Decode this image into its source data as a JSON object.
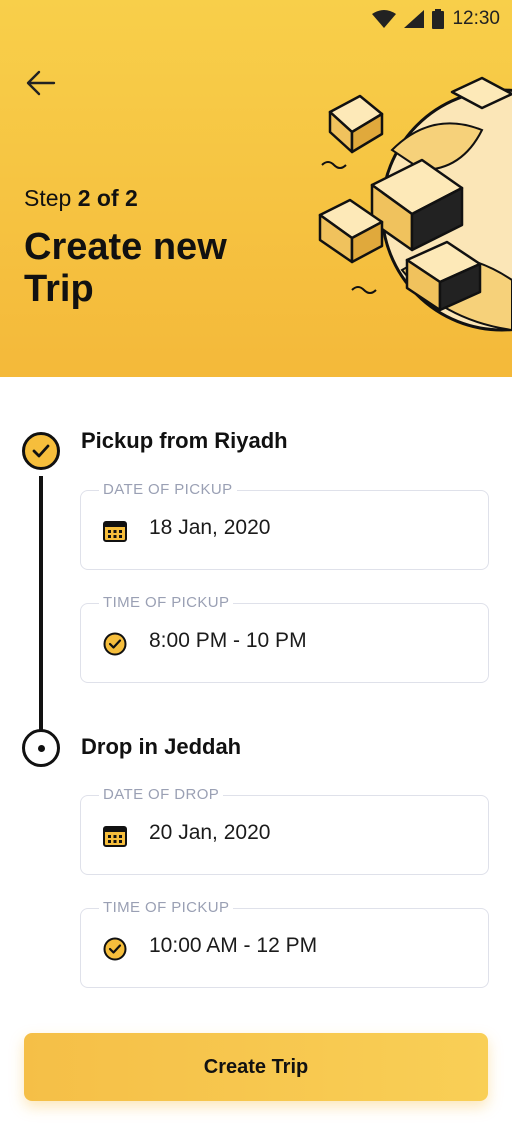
{
  "status_bar": {
    "time": "12:30"
  },
  "header": {
    "step_prefix": "Step",
    "step_value": "2 of 2",
    "title": "Create new Trip"
  },
  "pickup": {
    "title": "Pickup from Riyadh",
    "date_label": "DATE OF PICKUP",
    "date_value": "18 Jan, 2020",
    "time_label": "TIME OF PICKUP",
    "time_value": "8:00 PM - 10 PM"
  },
  "drop": {
    "title": "Drop in Jeddah",
    "date_label": "DATE OF DROP",
    "date_value": "20 Jan, 2020",
    "time_label": "TIME OF PICKUP",
    "time_value": "10:00 AM - 12 PM"
  },
  "cta": {
    "label": "Create Trip"
  },
  "colors": {
    "accent": "#f6be3c",
    "text": "#111111",
    "label": "#9aa0b4",
    "border": "#dfe1ea"
  },
  "icons": [
    "wifi-icon",
    "signal-icon",
    "battery-icon",
    "back-arrow-icon",
    "calendar-icon",
    "clock-check-icon",
    "check-icon"
  ]
}
